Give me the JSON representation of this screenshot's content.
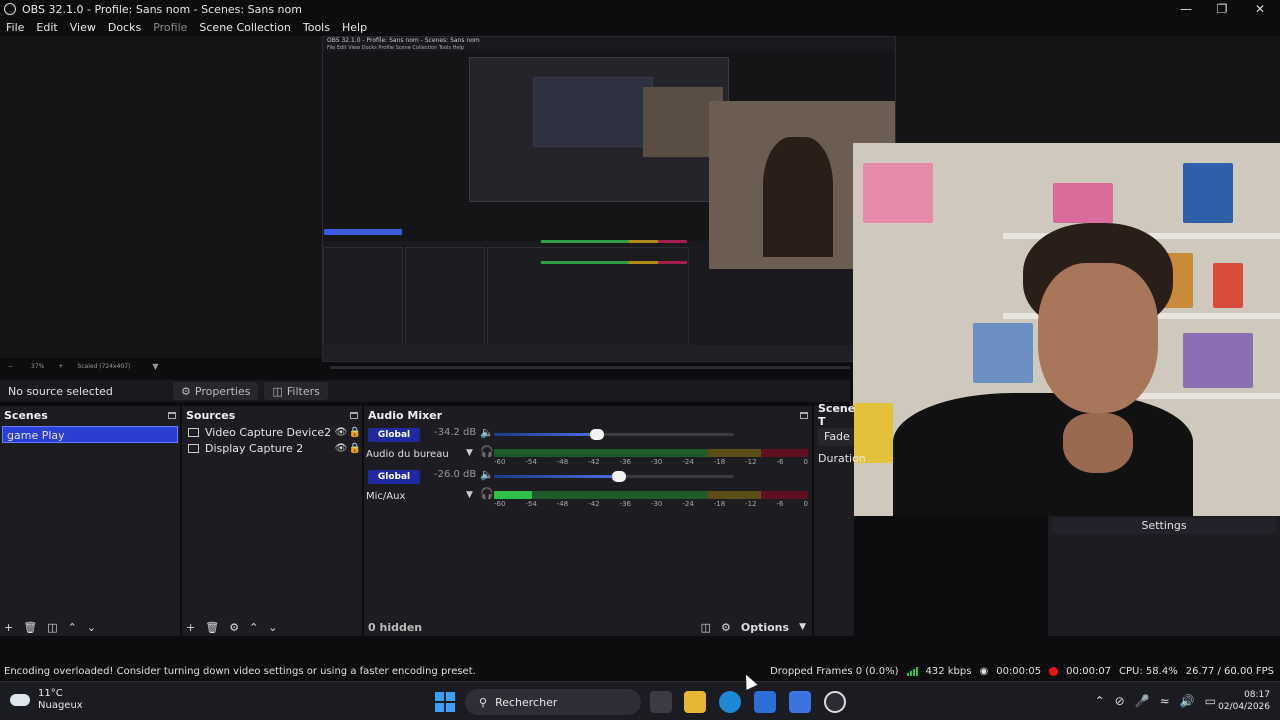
{
  "window": {
    "title": "OBS 32.1.0 - Profile: Sans nom - Scenes: Sans nom",
    "controls": [
      "minimize-icon",
      "maximize-icon",
      "close-icon"
    ]
  },
  "menu": {
    "file": "File",
    "edit": "Edit",
    "view": "View",
    "docks": "Docks",
    "profile": "Profile",
    "scene_collection": "Scene Collection",
    "tools": "Tools",
    "help": "Help"
  },
  "nested_capture": {
    "title": "OBS 32.1.0 - Profile: Sans nom - Scenes: Sans nom",
    "menu": "File  Edit  View  Docks  Profile  Scene Collection  Tools  Help"
  },
  "preview_bar": {
    "zoom": "37%",
    "scale": "Scaled (724x407)"
  },
  "source_toolbar": {
    "no_source": "No source selected",
    "properties": "Properties",
    "filters": "Filters"
  },
  "scenes": {
    "header": "Scenes",
    "items": [
      "game Play"
    ]
  },
  "sources": {
    "header": "Sources",
    "items": [
      {
        "name": "Video Capture Device2",
        "icon": "camera-icon"
      },
      {
        "name": "Display Capture 2",
        "icon": "monitor-icon"
      }
    ]
  },
  "audio_mixer": {
    "header": "Audio Mixer",
    "channels": [
      {
        "mode": "Global",
        "db": "-34.2 dB",
        "name": "Audio du bureau",
        "volume_fraction": 0.43,
        "level_fraction": 0.0
      },
      {
        "mode": "Global",
        "db": "-26.0 dB",
        "name": "Mic/Aux",
        "volume_fraction": 0.52,
        "level_fraction": 0.12
      }
    ],
    "ticks": [
      "-60",
      "-54",
      "-48",
      "-42",
      "-36",
      "-30",
      "-24",
      "-18",
      "-12",
      "-6",
      "0"
    ],
    "hidden": "0 hidden",
    "options": "Options"
  },
  "scene_transitions": {
    "header": "Scene T",
    "fade": "Fade",
    "duration": "Duration"
  },
  "controls": {
    "settings": "Settings"
  },
  "status": {
    "warning": "Encoding overloaded! Consider turning down video settings or using a faster encoding preset.",
    "dropped": "Dropped Frames 0 (0.0%)",
    "bitrate": "432 kbps",
    "stream_time": "00:00:05",
    "rec_time": "00:00:07",
    "cpu": "CPU: 58.4%",
    "fps": "26.77 / 60.00 FPS"
  },
  "taskbar": {
    "temp": "11°C",
    "weather": "Nuageux",
    "search": "Rechercher",
    "time": "08:17",
    "date": "02/04/2026"
  },
  "colors": {
    "accent": "#2a3fd1",
    "meter_green": "#2fbf4a",
    "record_red": "#e11111"
  }
}
